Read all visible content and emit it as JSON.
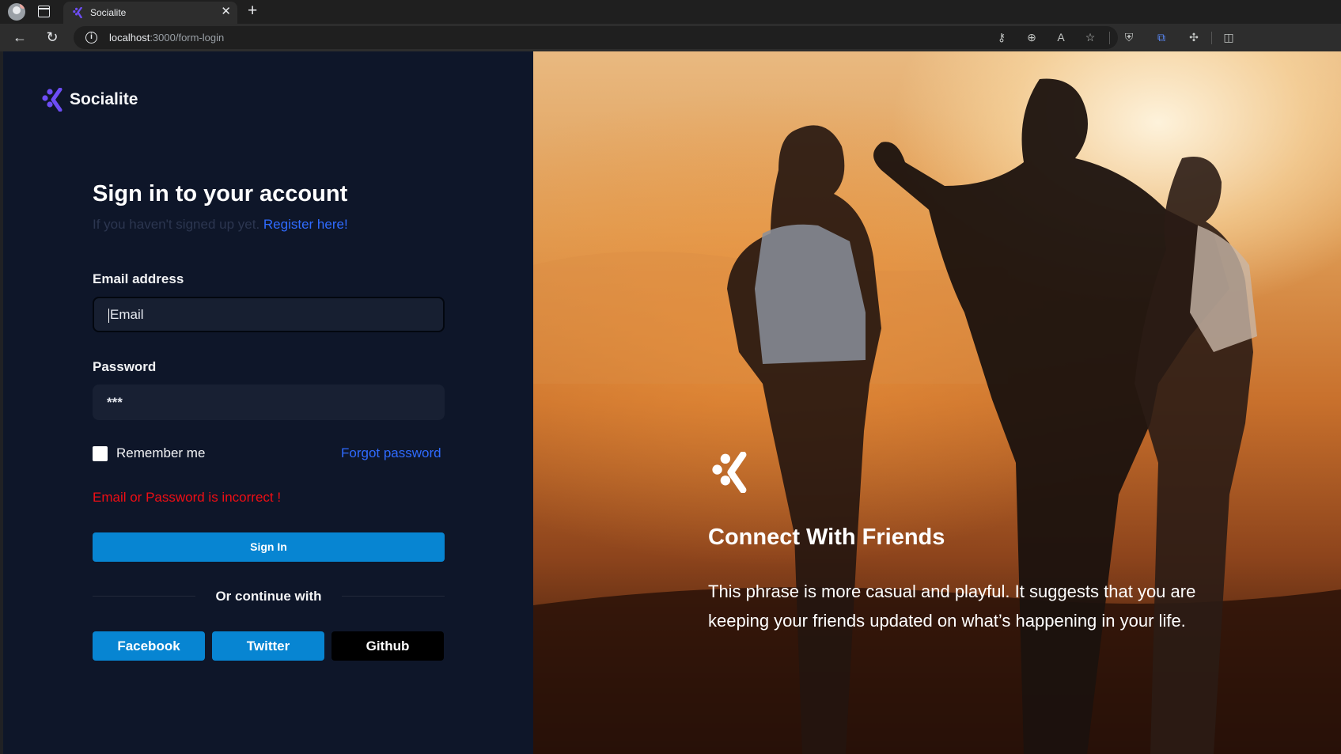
{
  "browser": {
    "tab_title": "Socialite",
    "url_host": "localhost",
    "url_path": ":3000/form-login"
  },
  "brand": {
    "name": "Socialite",
    "accent": "#6d4df5"
  },
  "form": {
    "title": "Sign in to your account",
    "subtitle": "If you haven't signed up yet.",
    "register_link": "Register here!",
    "email_label": "Email address",
    "email_placeholder": "Email",
    "password_label": "Password",
    "password_value": "***",
    "remember_label": "Remember me",
    "forgot_link": "Forgot password",
    "error_message": "Email or Password is incorrect !",
    "signin_label": "Sign In",
    "divider_text": "Or continue with",
    "social": {
      "facebook": "Facebook",
      "twitter": "Twitter",
      "github": "Github"
    }
  },
  "hero": {
    "title": "Connect With Friends",
    "text": "This phrase is more casual and playful. It suggests that you are keeping your friends updated on what’s happening in your life."
  },
  "colors": {
    "panel_bg": "#0e1629",
    "link": "#2f6bff",
    "error": "#f00e14",
    "primary_button": "#0785d2",
    "github_button": "#000000"
  }
}
